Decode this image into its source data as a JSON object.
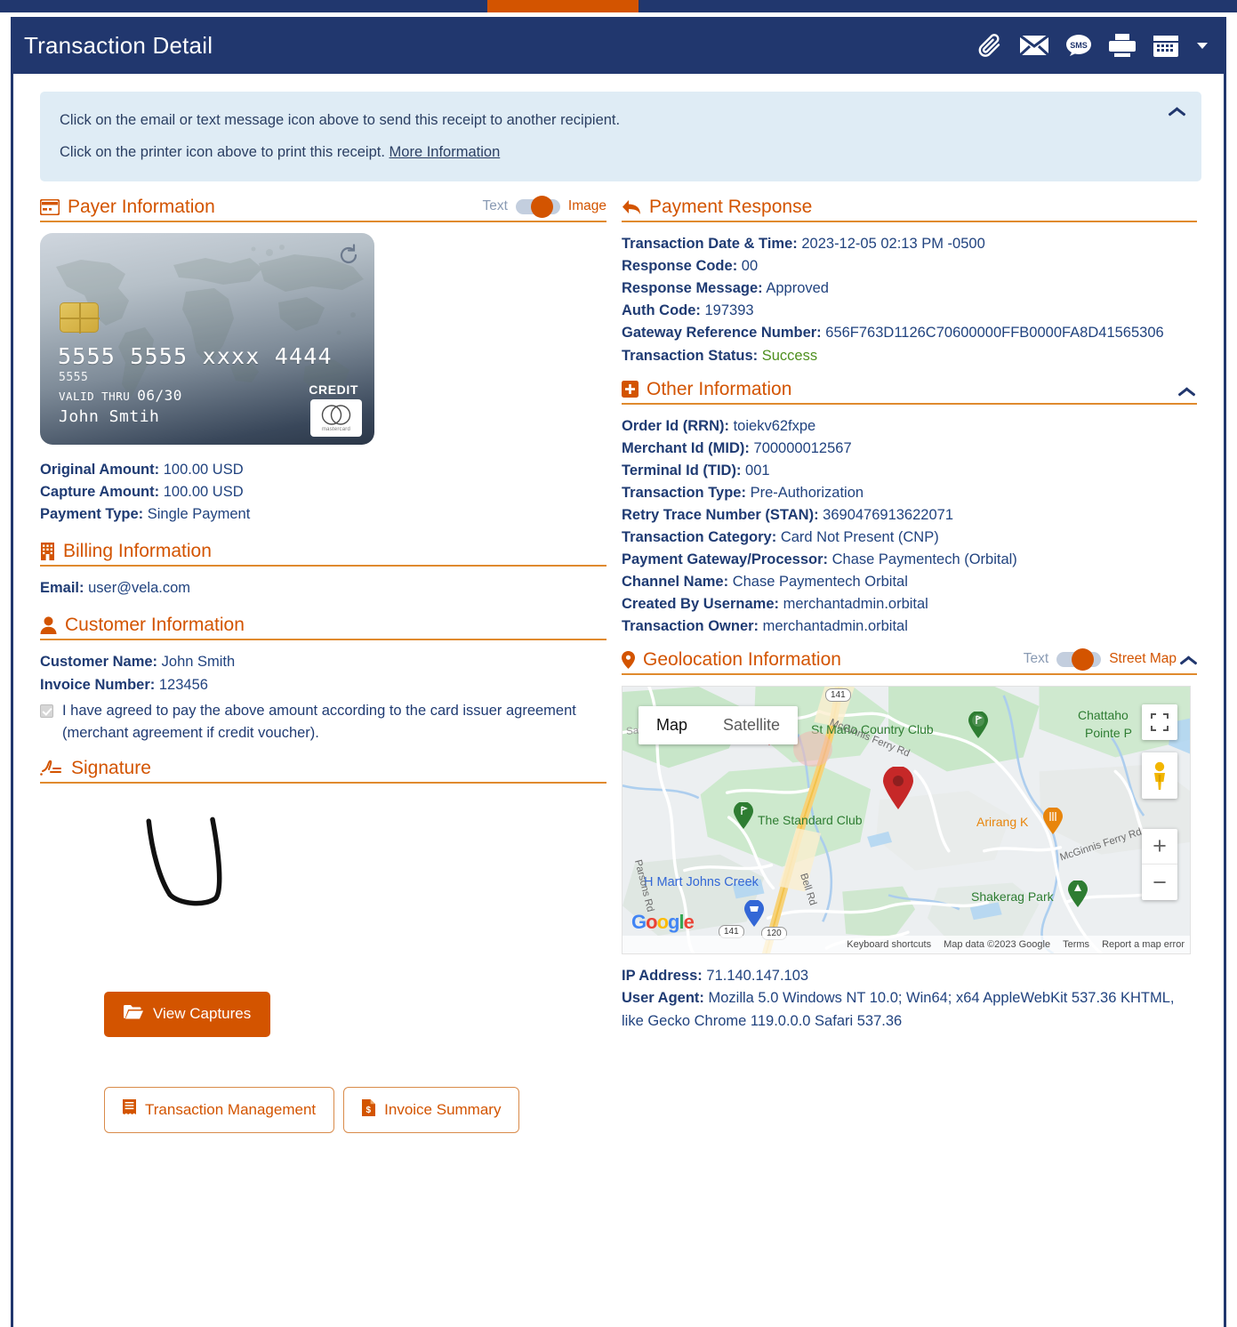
{
  "header": {
    "title": "Transaction Detail",
    "icons": [
      {
        "name": "paperclip-icon",
        "label": "Attach"
      },
      {
        "name": "envelope-icon",
        "label": "Email"
      },
      {
        "name": "sms-icon",
        "label": "SMS"
      },
      {
        "name": "printer-icon",
        "label": "Print"
      },
      {
        "name": "calendar-icon",
        "label": "Calendar"
      }
    ]
  },
  "alert": {
    "line1": "Click on the email or text message icon above to send this receipt to another recipient.",
    "line2_prefix": "Click on the printer icon above to print this receipt. ",
    "line2_link": "More Information"
  },
  "payer": {
    "section_title": "Payer Information",
    "toggle": {
      "left": "Text",
      "right": "Image",
      "state": "right"
    },
    "card": {
      "number": "5555 5555 xxxx 4444",
      "sub": "5555",
      "valid_label": "VALID THRU",
      "valid_value": "06/30",
      "holder": "John Smtih",
      "type": "CREDIT",
      "brand": "mastercard"
    },
    "fields": [
      {
        "label": "Original Amount:",
        "value": "100.00 USD"
      },
      {
        "label": "Capture Amount:",
        "value": "100.00 USD"
      },
      {
        "label": "Payment Type:",
        "value": "Single Payment"
      }
    ]
  },
  "billing": {
    "section_title": "Billing Information",
    "fields": [
      {
        "label": "Email:",
        "value": "user@vela.com"
      }
    ]
  },
  "customer": {
    "section_title": "Customer Information",
    "fields": [
      {
        "label": "Customer Name:",
        "value": "John Smith"
      },
      {
        "label": "Invoice Number:",
        "value": "123456"
      }
    ],
    "agreement": "I have agreed to pay the above amount according to the card issuer agreement (merchant agreement if credit voucher).",
    "agreement_checked": true
  },
  "signature": {
    "section_title": "Signature"
  },
  "payment_response": {
    "section_title": "Payment Response",
    "fields": [
      {
        "label": "Transaction Date & Time:",
        "value": "2023-12-05 02:13 PM -0500"
      },
      {
        "label": "Response Code:",
        "value": "00"
      },
      {
        "label": "Response Message:",
        "value": "Approved"
      },
      {
        "label": "Auth Code:",
        "value": "197393"
      },
      {
        "label": "Gateway Reference Number:",
        "value": "656F763D1126C70600000FFB0000FA8D41565306"
      },
      {
        "label": "Transaction Status:",
        "value": "Success",
        "status": true
      }
    ]
  },
  "other_information": {
    "section_title": "Other Information",
    "fields": [
      {
        "label": "Order Id (RRN):",
        "value": "toiekv62fxpe"
      },
      {
        "label": "Merchant Id (MID):",
        "value": "700000012567"
      },
      {
        "label": "Terminal Id (TID):",
        "value": "001"
      },
      {
        "label": "Transaction Type:",
        "value": "Pre-Authorization"
      },
      {
        "label": "Retry Trace Number (STAN):",
        "value": "3690476913622071"
      },
      {
        "label": "Transaction Category:",
        "value": "Card Not Present (CNP)"
      },
      {
        "label": "Payment Gateway/Processor:",
        "value": "Chase Paymentech (Orbital)"
      },
      {
        "label": "Channel Name:",
        "value": "Chase Paymentech Orbital"
      },
      {
        "label": "Created By Username:",
        "value": "merchantadmin.orbital"
      },
      {
        "label": "Transaction Owner:",
        "value": "merchantadmin.orbital"
      }
    ]
  },
  "geolocation": {
    "section_title": "Geolocation Information",
    "toggle": {
      "left": "Text",
      "right": "Street Map",
      "state": "right"
    },
    "map": {
      "type_map": "Map",
      "type_satellite": "Satellite",
      "attribution": "Google",
      "footer": [
        "Keyboard shortcuts",
        "Map data ©2023 Google",
        "Terms",
        "Report a map error"
      ],
      "zoom_in": "+",
      "zoom_out": "−",
      "labels": [
        "St Marlo Country Club",
        "The Standard Club",
        "Chattaho",
        "Pointe P",
        "Arirang K",
        "Shakerag Park",
        "H Mart Johns Creek",
        "McGinnis Ferry Rd",
        "Bell Rd",
        "Parsons Rd",
        "Sargent Rd",
        "141",
        "120"
      ]
    },
    "fields": [
      {
        "label": "IP Address:",
        "value": "71.140.147.103"
      },
      {
        "label": "User Agent:",
        "value": "Mozilla 5.0 Windows NT 10.0; Win64; x64 AppleWebKit 537.36 KHTML, like Gecko Chrome 119.0.0.0 Safari 537.36"
      }
    ]
  },
  "buttons": {
    "view_captures": "View Captures",
    "transaction_management": "Transaction Management",
    "invoice_summary": "Invoice Summary"
  },
  "colors": {
    "navy": "#21376e",
    "orange": "#d35400",
    "alert_bg": "#dfecf5",
    "success_green": "#4e8f1e"
  }
}
